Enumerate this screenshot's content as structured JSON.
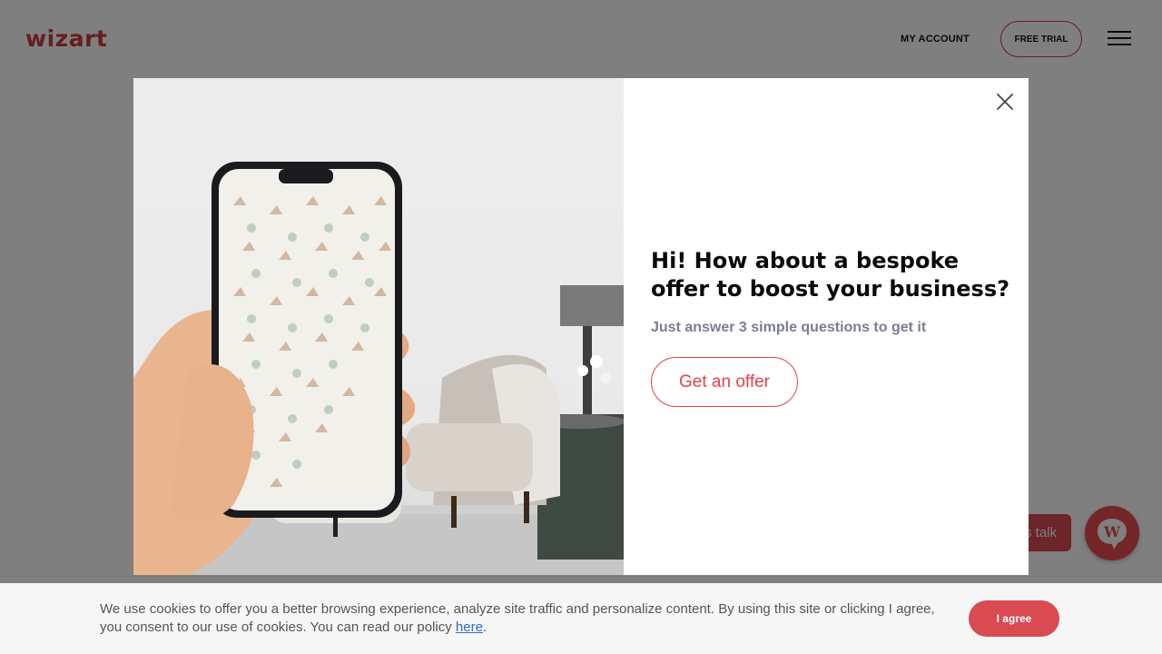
{
  "header": {
    "logo": "wizart",
    "my_account": "MY ACCOUNT",
    "free_trial": "FREE TRIAL"
  },
  "chat": {
    "pill_label": "s talk"
  },
  "modal": {
    "headline": "Hi! How about a bespoke offer to boost your business?",
    "subline": "Just answer 3 simple questions to get it",
    "cta": "Get an offer"
  },
  "cookie": {
    "text": "We use cookies to offer you a better browsing experience, analyze site traffic and personalize content. By using this site or clicking I agree, you consent to our use of cookies. You can read our policy ",
    "link": "here",
    "end": ".",
    "agree": "I agree"
  },
  "colors": {
    "brand": "#cf3a3f",
    "cta": "#e6414a",
    "overlay": "rgba(0,0,0,0.5)"
  }
}
